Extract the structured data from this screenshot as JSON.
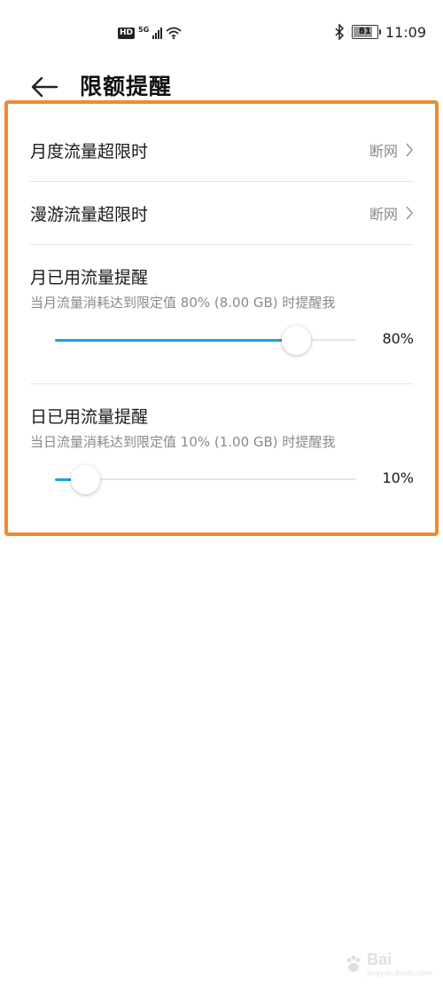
{
  "status_bar": {
    "hd_badge": "HD",
    "network_type": "5G",
    "battery_level": "81",
    "time": "11:09",
    "icons": [
      "hd-icon",
      "signal-icon",
      "wifi-icon",
      "bluetooth-icon",
      "battery-icon"
    ]
  },
  "header": {
    "back_icon": "arrow-left-icon",
    "title": "限额提醒"
  },
  "settings": {
    "monthly_over_limit": {
      "label": "月度流量超限时",
      "value": "断网"
    },
    "roaming_over_limit": {
      "label": "漫游流量超限时",
      "value": "断网"
    },
    "monthly_reminder": {
      "title": "月已用流量提醒",
      "description": "当月流量消耗达到限定值 80% (8.00 GB) 时提醒我",
      "percent": 80,
      "percent_label": "80%"
    },
    "daily_reminder": {
      "title": "日已用流量提醒",
      "description": "当日流量消耗达到限定值 10% (1.00 GB) 时提醒我",
      "percent": 10,
      "percent_label": "10%"
    }
  },
  "colors": {
    "accent": "#1aa0e0",
    "highlight_border": "#f08a35",
    "secondary_text": "#8a8a8a"
  },
  "watermark": {
    "text": "Bai",
    "sub": "jingyan.baidu.com"
  }
}
